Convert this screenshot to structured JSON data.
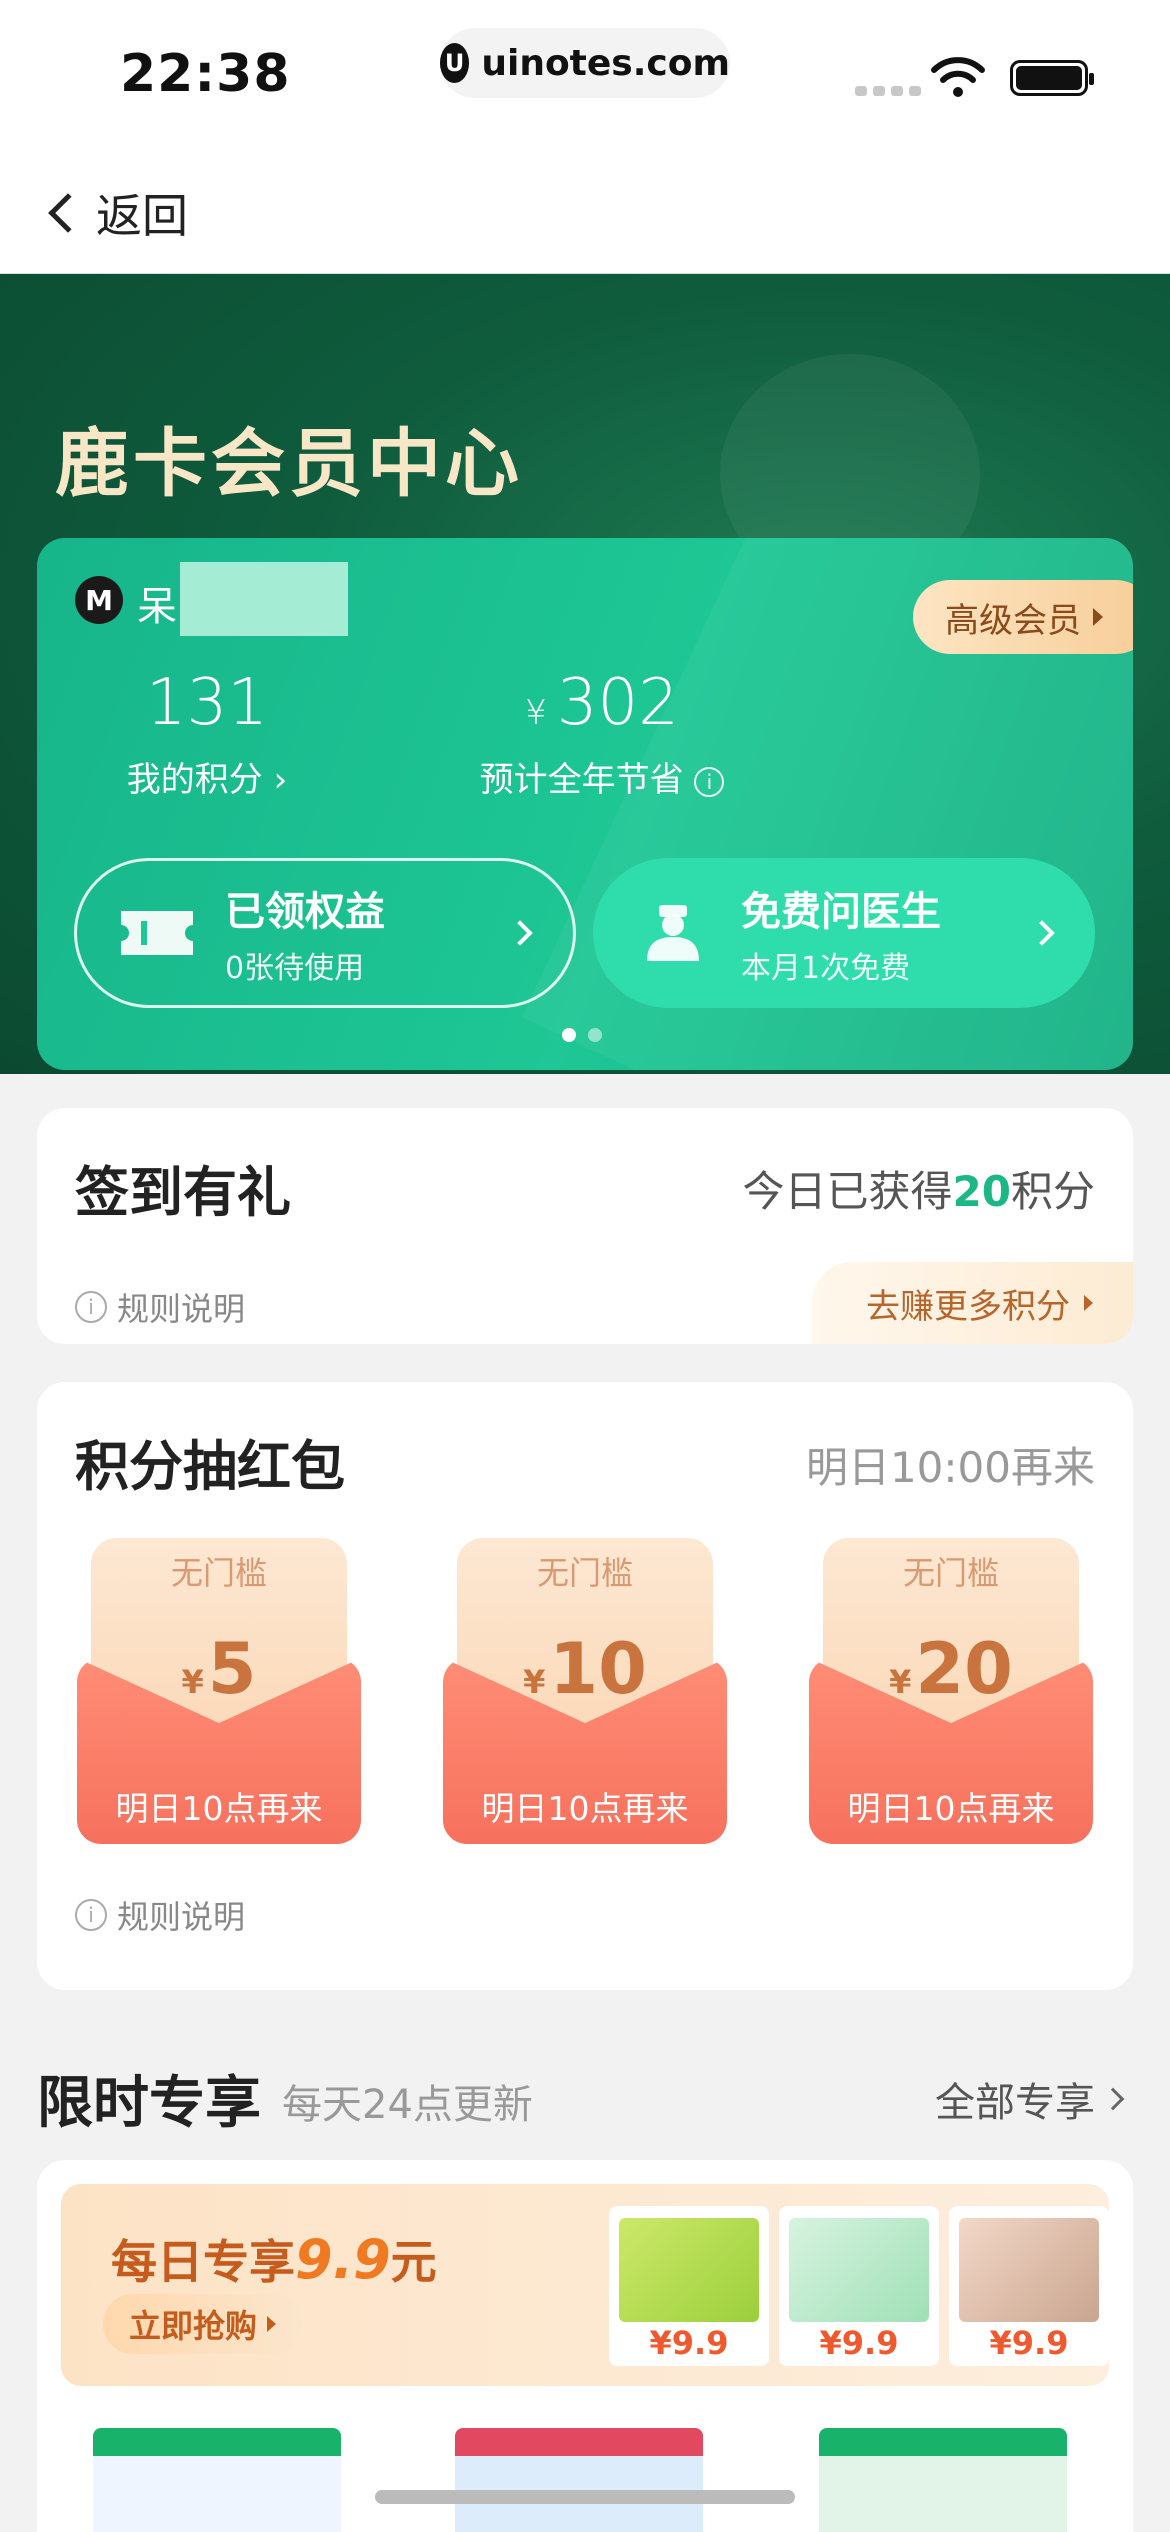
{
  "status_bar": {
    "time": "22:38",
    "url": "uinotes.com",
    "logo_glyph": "U"
  },
  "nav": {
    "back_label": "返回"
  },
  "hero": {
    "title": "鹿卡会员中心",
    "member": {
      "badge_glyph": "M",
      "name": "呆",
      "level_label": "高级会员",
      "points_value": "131",
      "points_label": "我的积分 ›",
      "savings_currency": "¥",
      "savings_value": "302",
      "savings_label": "预计全年节省",
      "benefits": [
        {
          "title": "已领权益",
          "subtitle": "0张待使用"
        },
        {
          "title": "免费问医生",
          "subtitle": "本月1次免费"
        }
      ],
      "page_dots": 2,
      "active_dot": 0
    }
  },
  "signin": {
    "title": "签到有礼",
    "today_prefix": "今日已获得",
    "today_points": "20",
    "today_suffix": "积分",
    "rule_label": "规则说明",
    "earn_more": "去赚更多积分"
  },
  "lottery": {
    "title": "积分抽红包",
    "next_time": "明日10:00再来",
    "envelopes": [
      {
        "tag": "无门槛",
        "currency": "¥",
        "amount": "5",
        "cta": "明日10点再来"
      },
      {
        "tag": "无门槛",
        "currency": "¥",
        "amount": "10",
        "cta": "明日10点再来"
      },
      {
        "tag": "无门槛",
        "currency": "¥",
        "amount": "20",
        "cta": "明日10点再来"
      }
    ],
    "rule_label": "规则说明"
  },
  "limited": {
    "title": "限时专享",
    "subtitle": "每天24点更新",
    "all_label": "全部专享",
    "promo": {
      "title_prefix": "每日专享",
      "title_price": "9.9",
      "title_suffix": "元",
      "button": "立即抢购",
      "products": [
        {
          "price": "¥9.9"
        },
        {
          "price": "¥9.9"
        },
        {
          "price": "¥9.9"
        }
      ]
    }
  },
  "colors": {
    "brand_green": "#1ec795",
    "hero_dark": "#0f5c3d",
    "gold_text": "#f7e7c6",
    "points_green": "#1bb886",
    "orange": "#c55c1e"
  }
}
